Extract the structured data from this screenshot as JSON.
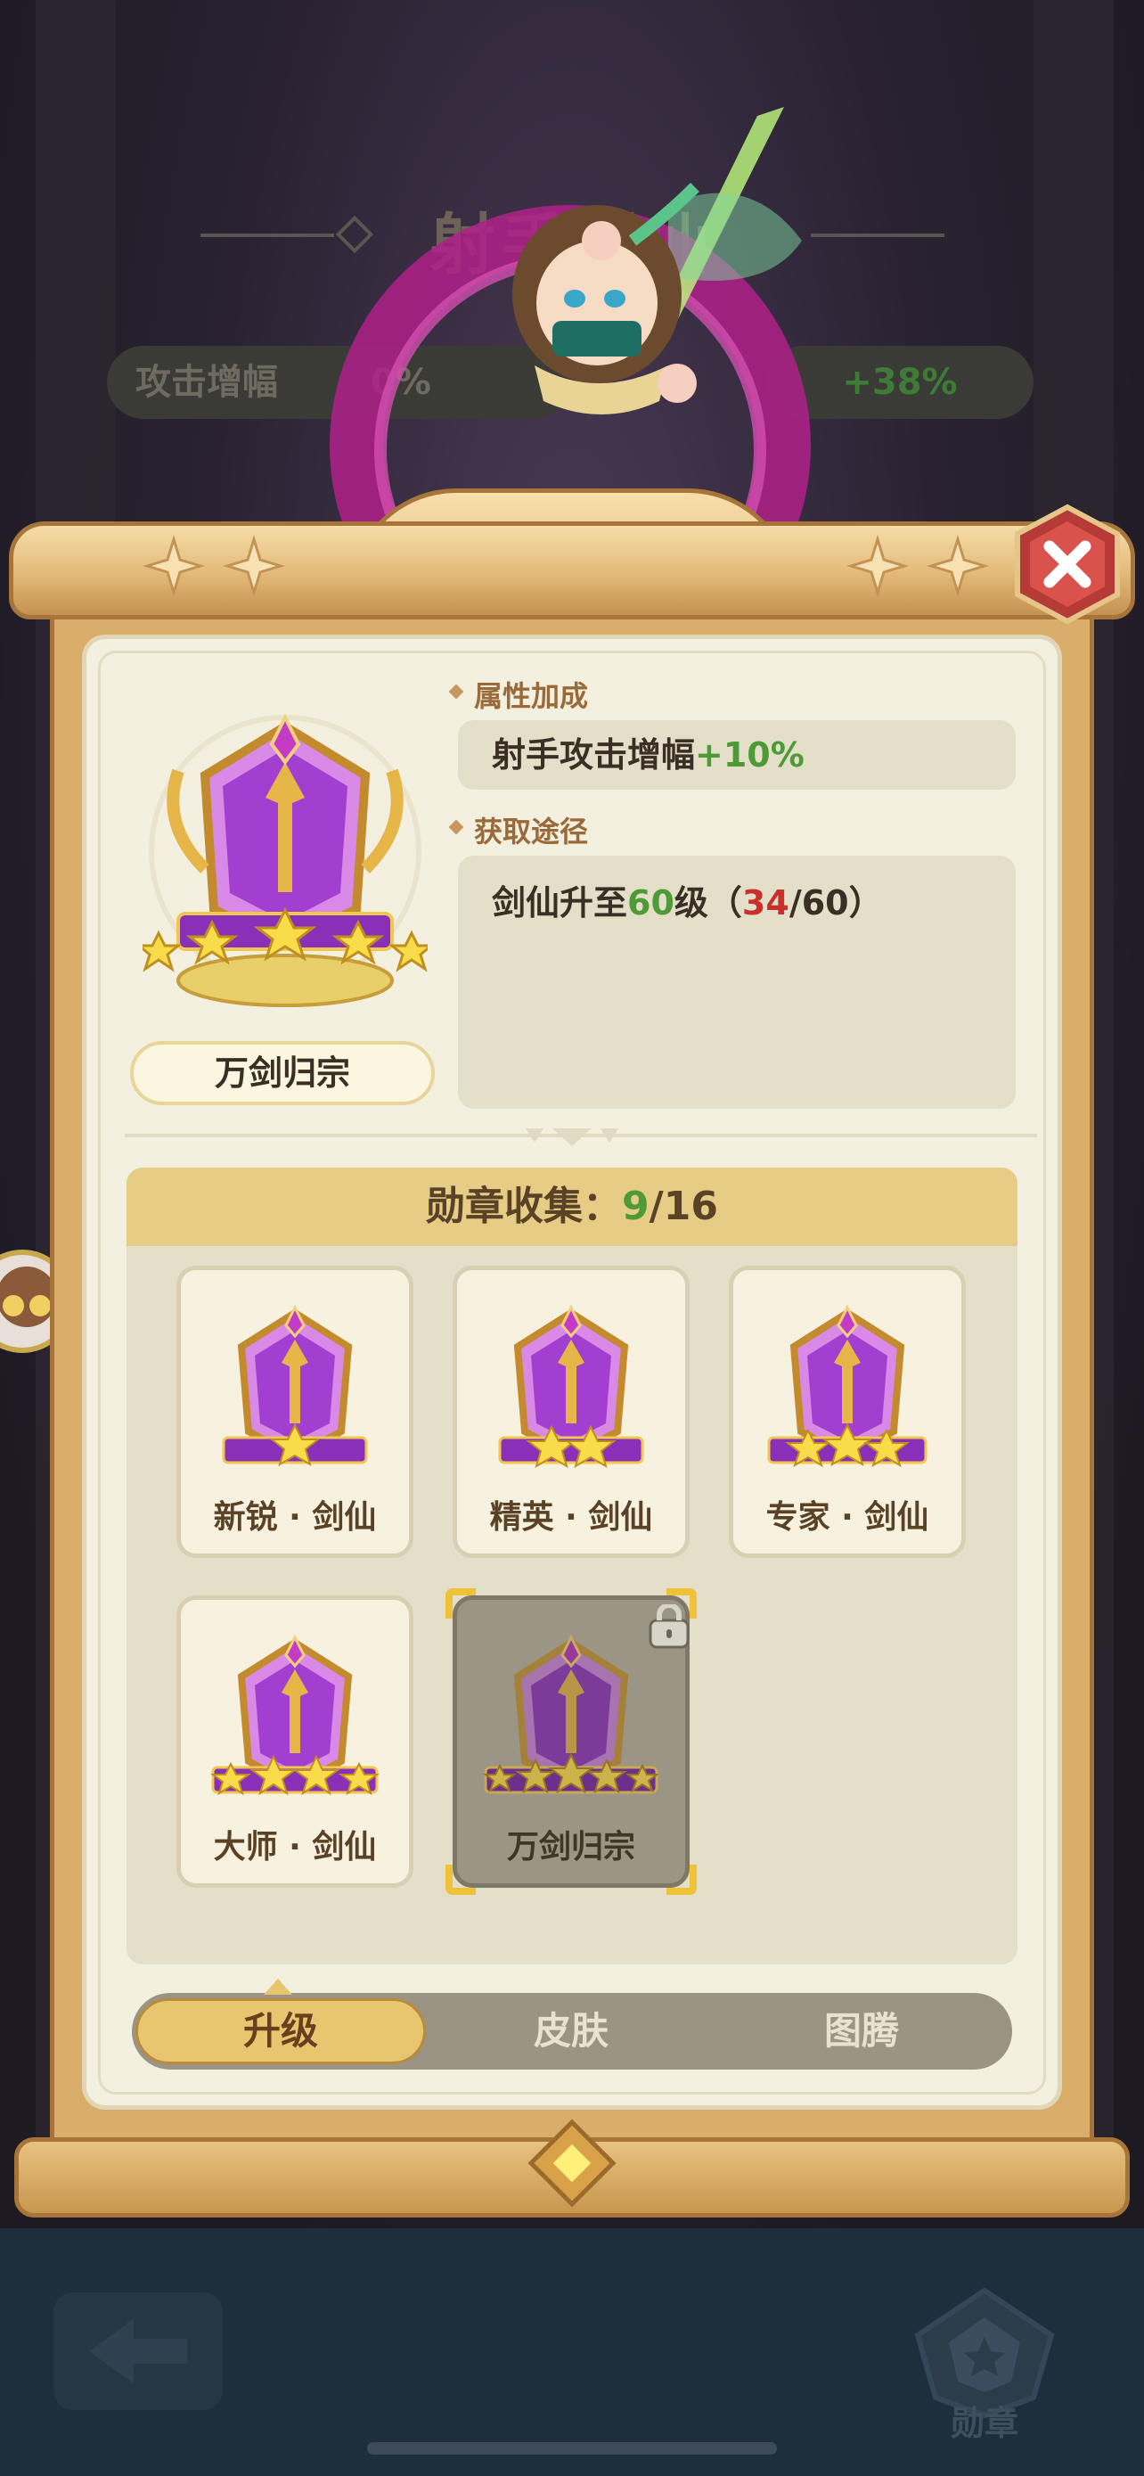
{
  "background": {
    "title": "射手剑仙",
    "stat_label": "攻击增幅",
    "stat_value_left": "0%",
    "stat_value_right": "+38%"
  },
  "medal_detail": {
    "name": "万剑归宗",
    "stars": 5,
    "attribute_heading": "属性加成",
    "attribute_text": "射手攻击增幅",
    "attribute_bonus": "+10%",
    "source_heading": "获取途径",
    "source_prefix": "剑仙升至",
    "source_level": "60",
    "source_unit": "级（",
    "progress_current": "34",
    "progress_sep": "/",
    "progress_total": "60",
    "source_suffix": "）"
  },
  "collection": {
    "label": "勋章收集：",
    "collected": "9",
    "sep": "/",
    "total": "16",
    "medals": [
      {
        "label": "新锐 · 剑仙",
        "stars": 1,
        "locked": false
      },
      {
        "label": "精英 · 剑仙",
        "stars": 2,
        "locked": false
      },
      {
        "label": "专家 · 剑仙",
        "stars": 3,
        "locked": false
      },
      {
        "label": "大师 · 剑仙",
        "stars": 4,
        "locked": false
      },
      {
        "label": "万剑归宗",
        "stars": 5,
        "locked": true,
        "selected": true
      }
    ]
  },
  "tabs": [
    {
      "label": "升级",
      "active": true
    },
    {
      "label": "皮肤",
      "active": false
    },
    {
      "label": "图腾",
      "active": false
    }
  ],
  "bottom_nav": {
    "medal_label": "勋章"
  },
  "colors": {
    "accent_green": "#4e9a37",
    "accent_red": "#c9302c",
    "gold": "#e8c670",
    "medal_purple": "#a23fd0"
  },
  "icons": [
    "close-icon",
    "back-arrow-icon",
    "medal-nav-icon",
    "lock-icon",
    "diamond-gem-icon"
  ]
}
